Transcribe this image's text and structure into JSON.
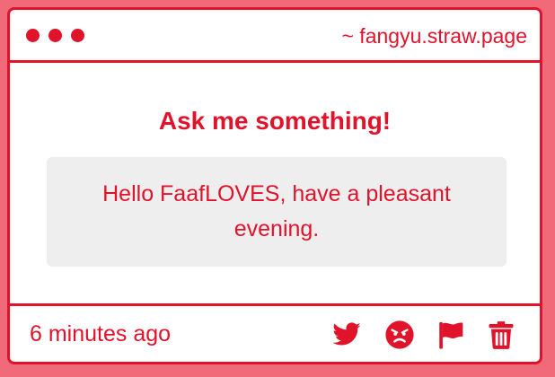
{
  "window": {
    "url": "~ fangyu.straw.page"
  },
  "main": {
    "heading": "Ask me something!",
    "message": "Hello FaafLOVES, have a pleasant evening."
  },
  "footer": {
    "timestamp": "6 minutes ago",
    "actions": [
      {
        "icon": "twitter-icon"
      },
      {
        "icon": "angry-face-icon"
      },
      {
        "icon": "flag-icon"
      },
      {
        "icon": "trash-icon"
      }
    ]
  },
  "colors": {
    "accent": "#e0132b",
    "background": "#f06a79",
    "card": "#ffffff",
    "message_box": "#eeeeef"
  }
}
